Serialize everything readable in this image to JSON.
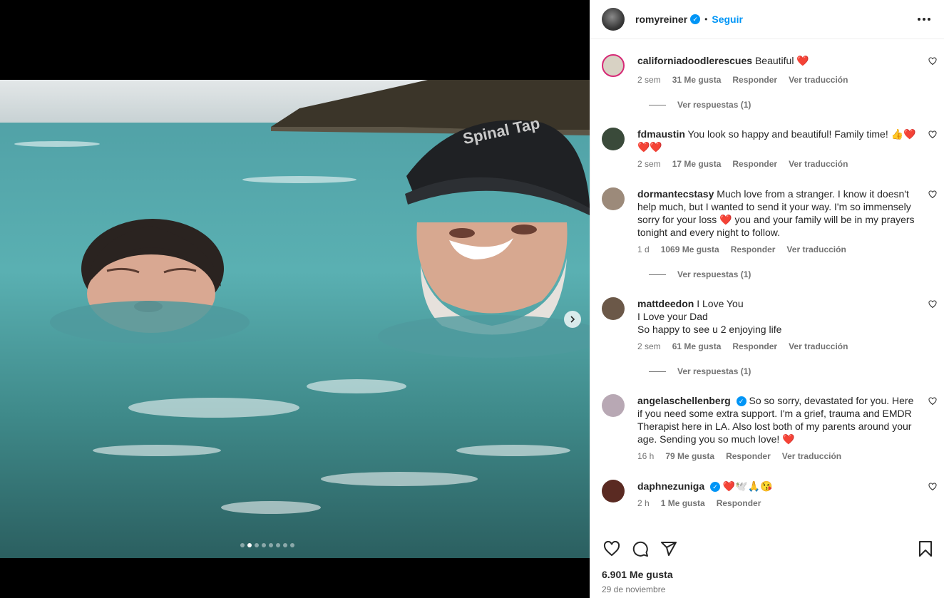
{
  "post": {
    "username": "romyreiner",
    "follow_label": "Seguir",
    "likes": "6.901 Me gusta",
    "date": "29 de noviembre",
    "media": {
      "carousel_count": 8,
      "carousel_active": 2
    }
  },
  "comments": [
    {
      "username": "californiadoodlerescues",
      "text": "Beautiful",
      "emoji": "❤️",
      "time": "2 sem",
      "likes": "31 Me gusta",
      "reply": "Responder",
      "translate": "Ver traducción",
      "replies": "Ver respuestas (1)",
      "avatar_color": "#d8d2c4"
    },
    {
      "username": "fdmaustin",
      "text": "You look so happy and beautiful! Family time!",
      "emoji": "👍❤️❤️❤️",
      "time": "2 sem",
      "likes": "17 Me gusta",
      "reply": "Responder",
      "translate": "Ver traducción",
      "avatar_color": "#3a4a3a"
    },
    {
      "username": "dormantecstasy",
      "text": "Much love from a stranger. I know it doesn't help much, but I wanted to send it your way. I'm so immensely sorry for your loss ❤️ you and your family will be in my prayers tonight and every night to follow.",
      "time": "1 d",
      "likes": "1069 Me gusta",
      "reply": "Responder",
      "translate": "Ver traducción",
      "replies": "Ver respuestas (1)",
      "avatar_color": "#9c8a7a"
    },
    {
      "username": "mattdeedon",
      "text": "I Love You",
      "text2": "I Love your Dad",
      "text3": "So happy to see u 2 enjoying life",
      "time": "2 sem",
      "likes": "61 Me gusta",
      "reply": "Responder",
      "translate": "Ver traducción",
      "replies": "Ver respuestas (1)",
      "avatar_color": "#6b5848"
    },
    {
      "username": "angelaschellenberg",
      "text": "So so sorry, devastated for you. Here if you need some extra support. I'm a grief, trauma and EMDR Therapist here in LA. Also lost both of my parents around your age. Sending you so much love! ❤️",
      "time": "16 h",
      "likes": "79 Me gusta",
      "reply": "Responder",
      "translate": "Ver traducción",
      "avatar_color": "#b8a8b4"
    },
    {
      "username": "daphnezuniga",
      "emoji": "❤️🕊️🙏😘",
      "time": "2 h",
      "likes": "1 Me gusta",
      "reply": "Responder",
      "avatar_color": "#5a2a22"
    }
  ],
  "icons": {
    "like": "heart-icon",
    "comment": "comment-icon",
    "share": "share-icon",
    "save": "bookmark-icon",
    "more": "more-icon",
    "next": "chevron-right-icon"
  },
  "colors": {
    "accent": "#0095f6",
    "text": "#262626",
    "muted": "#737373"
  }
}
